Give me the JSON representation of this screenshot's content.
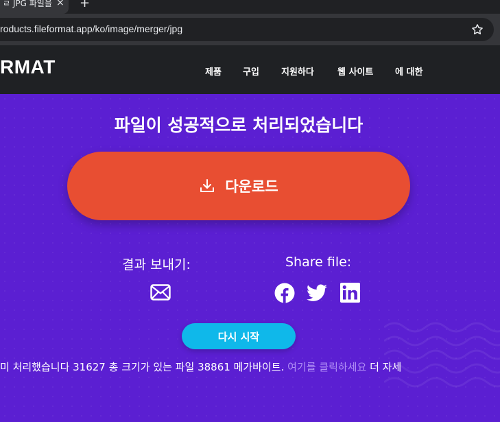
{
  "browser": {
    "tab_title": "ㄹ JPG 파일을",
    "tab_close": "×",
    "new_tab": "+",
    "url": "roducts.fileformat.app/ko/image/merger/jpg"
  },
  "header": {
    "brand": "RMAT",
    "nav": [
      "제품",
      "구입",
      "지원하다",
      "웹 사이트",
      "에 대한"
    ]
  },
  "main": {
    "title": "파일이 성공적으로 처리되었습니다",
    "download_label": "다운로드",
    "send_label": "결과 보내기:",
    "share_label": "Share file:",
    "restart_label": "다시 시작",
    "info_text": "미 처리했습니다 31627 총 크기가 있는 파일 38861 메가바이트.",
    "info_link": "여기를 클릭하세요",
    "info_tail": "더 자세"
  },
  "colors": {
    "background": "#5b1fd2",
    "header": "#1f2124",
    "download": "#e84e32",
    "restart": "#0fb8ea",
    "link": "#b08ef5"
  },
  "icons": [
    "star-icon",
    "download-icon",
    "mail-icon",
    "facebook-icon",
    "twitter-icon",
    "linkedin-icon"
  ]
}
